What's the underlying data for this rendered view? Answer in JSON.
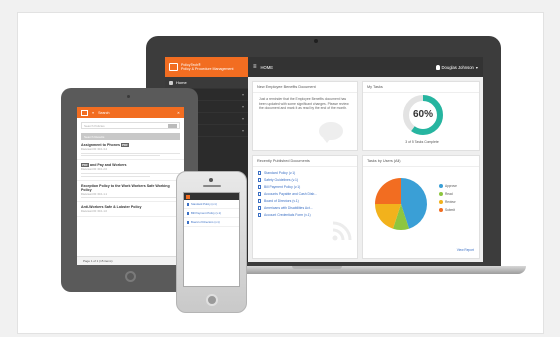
{
  "laptop": {
    "brand_line1": "PolicyTech®",
    "brand_line2": "Policy & Procedure Management",
    "sidebar_items": [
      {
        "label": "Home",
        "icon": "home-icon"
      },
      {
        "label": "",
        "icon": "doc-icon"
      },
      {
        "label": "",
        "icon": "folder-icon"
      },
      {
        "label": "",
        "icon": "check-icon"
      },
      {
        "label": "",
        "icon": "gear-icon"
      }
    ],
    "topbar": {
      "title": "HOME",
      "menu_icon": "≡",
      "user": "Douglas Johnson"
    },
    "notice": {
      "title": "New Employee Benefits Document",
      "body": "Just a reminder that the Employee Benefits document has been updated with some significant changes. Please review the document and mark it as read by the end of the month."
    },
    "tasks": {
      "title": "My Tasks",
      "percent": 60,
      "percent_label": "60%",
      "caption": "3 of 5 Tasks Complete"
    },
    "recent": {
      "title": "Recently Published Documents",
      "items": [
        "Standard Policy (v.1)",
        "Safety Guidelines (v.1)",
        "Bill Payment Policy (v.1)",
        "Accounts Payable and Cash Disb...",
        "Board of Directors (v.1)",
        "Americans with Disabilities Act...",
        "Account Credentials Form (v.1)"
      ]
    },
    "users": {
      "title": "Tasks by Users (All)",
      "legend": [
        {
          "label": "Approve",
          "color": "#3a9fd6"
        },
        {
          "label": "Read",
          "color": "#8dc63f"
        },
        {
          "label": "Review",
          "color": "#f2b21c"
        },
        {
          "label": "Submit",
          "color": "#f26d21"
        }
      ],
      "slices": [
        0.45,
        0.1,
        0.2,
        0.25
      ],
      "view_report": "View Report"
    }
  },
  "tablet": {
    "header_label": "Search",
    "search_placeholder": "Search Policies",
    "search_button": "Go",
    "results_bar": "Search Results",
    "results": [
      {
        "title": "Assignment to Phones",
        "tag": "PDF",
        "meta": "Document ID: 00.1.3.4"
      },
      {
        "title": "and Pay and Workers",
        "tag": "PDF",
        "meta": "Document ID: 00.1.2.6"
      },
      {
        "title": "Exception Policy to the Work Workers Safe Working Policy",
        "tag": "",
        "meta": "Document ID: 00.1.1.1"
      },
      {
        "title": "Anti-Workers Safe & Lobster Policy",
        "tag": "",
        "meta": "Document ID: 00.1.1.0"
      }
    ],
    "pager": "Page 1 of 1 (15 items)"
  },
  "phone": {
    "links": [
      "Standard Policy (v.1)",
      "Bill Payment Policy (v.1)",
      "Board of Directors (v.1)"
    ]
  },
  "colors": {
    "accent": "#f26d21",
    "teal": "#26b5a0",
    "link": "#3a6fc4"
  }
}
